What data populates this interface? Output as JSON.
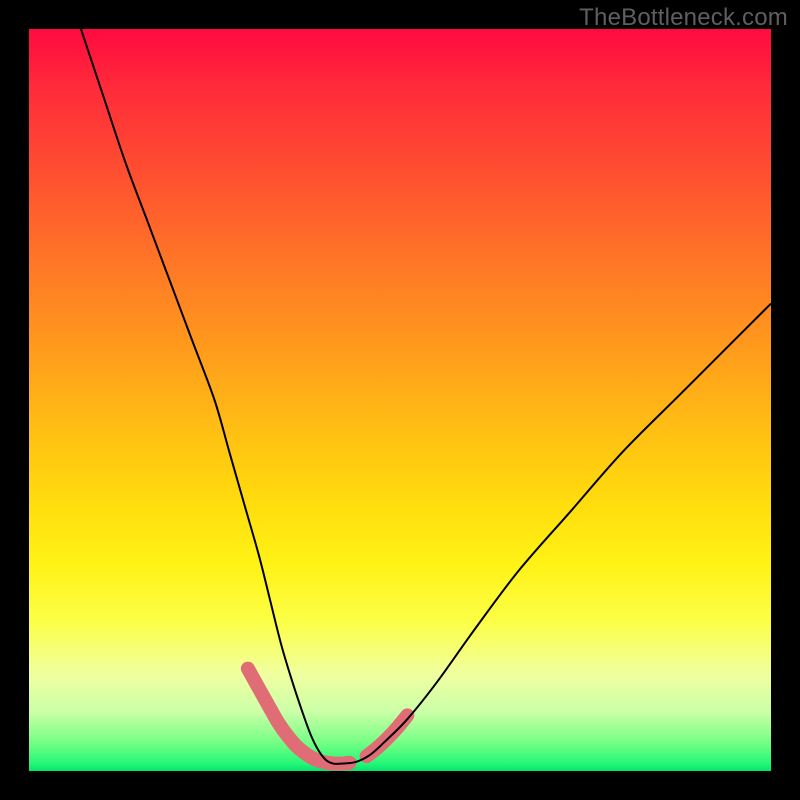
{
  "watermark": "TheBottleneck.com",
  "chart_data": {
    "type": "line",
    "title": "",
    "xlabel": "",
    "ylabel": "",
    "xlim": [
      0,
      100
    ],
    "ylim": [
      0,
      100
    ],
    "grid": false,
    "series": [
      {
        "name": "curve",
        "color": "#000000",
        "stroke_width": 2,
        "x": [
          7,
          10,
          13,
          16,
          19,
          22,
          25,
          27,
          29,
          31,
          32.5,
          34,
          35.5,
          37,
          38,
          39,
          40,
          41,
          42,
          44,
          46,
          48,
          51,
          55,
          60,
          66,
          73,
          80,
          88,
          96,
          100
        ],
        "y": [
          100,
          91,
          82,
          74,
          66,
          58,
          50,
          43,
          36,
          29,
          23,
          17,
          12,
          7.5,
          4.8,
          2.8,
          1.5,
          1.0,
          1.0,
          1.2,
          2.2,
          4.0,
          7.0,
          12,
          19,
          27,
          35,
          43,
          51,
          59,
          63
        ]
      },
      {
        "name": "highlight-left",
        "color": "#e06c75",
        "stroke_width": 14,
        "linecap": "round",
        "x": [
          29.5,
          31,
          32.4,
          33.6,
          34.8,
          36,
          37.2,
          38.3,
          39.3,
          40.3,
          41.2,
          42.2,
          43.2
        ],
        "y": [
          13.8,
          11.1,
          8.6,
          6.5,
          4.8,
          3.4,
          2.4,
          1.7,
          1.3,
          1.1,
          1.0,
          1.0,
          1.1
        ]
      },
      {
        "name": "highlight-right",
        "color": "#e06c75",
        "stroke_width": 14,
        "linecap": "round",
        "x": [
          45.5,
          46.8,
          48.2,
          49.6,
          51.0
        ],
        "y": [
          2.0,
          3.0,
          4.3,
          5.8,
          7.5
        ]
      }
    ]
  }
}
